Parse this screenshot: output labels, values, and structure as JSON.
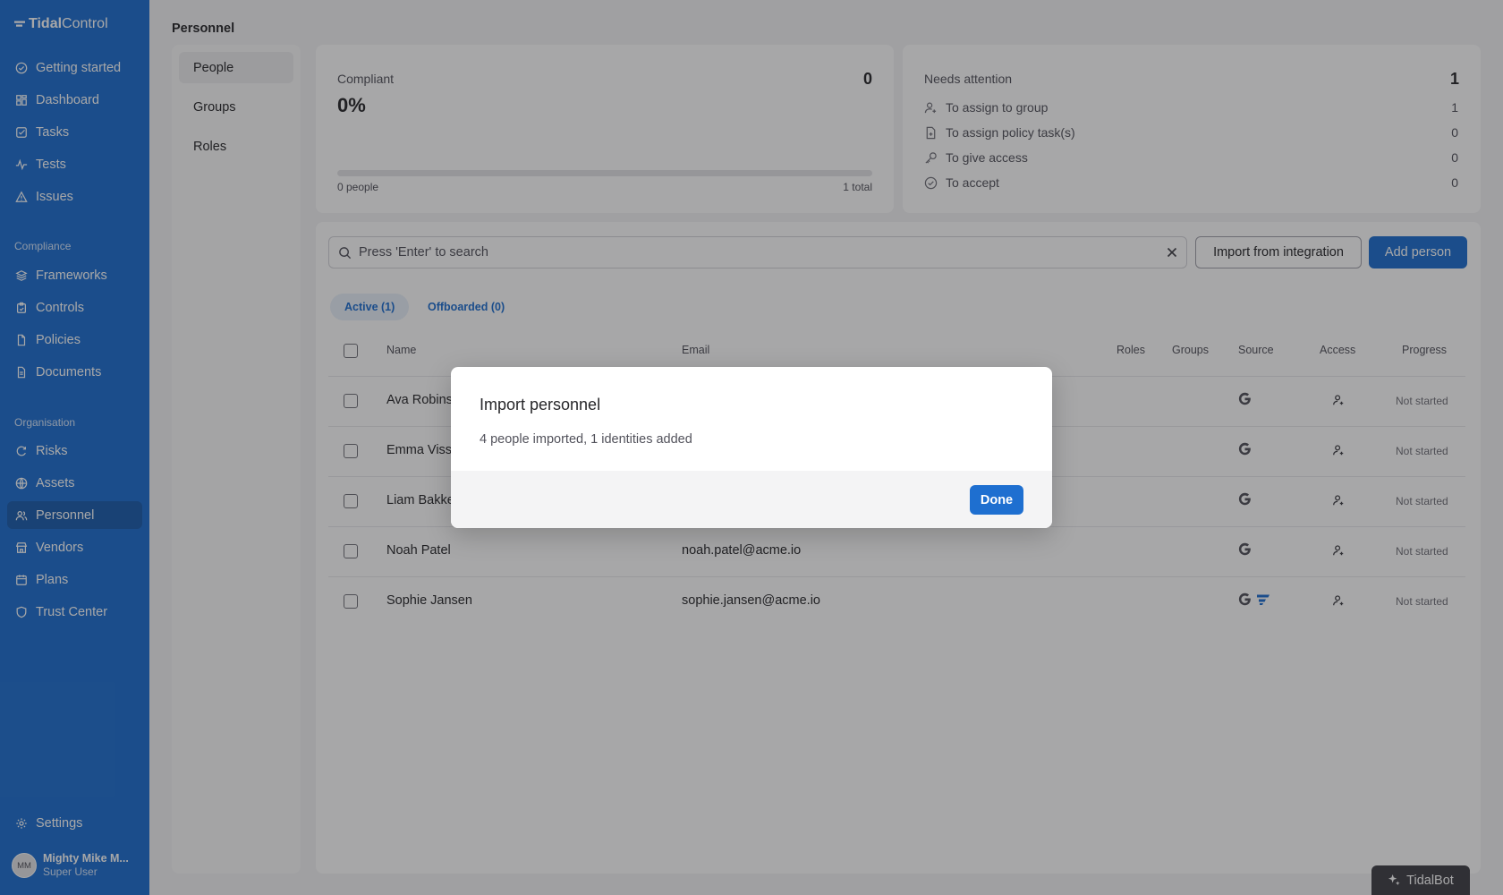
{
  "app": {
    "logo_bold": "Tidal",
    "logo_light": "Control"
  },
  "sidebar": {
    "top_items": [
      {
        "label": "Getting started",
        "icon": "check-circle-icon"
      },
      {
        "label": "Dashboard",
        "icon": "dashboard-icon"
      },
      {
        "label": "Tasks",
        "icon": "checkbox-icon"
      },
      {
        "label": "Tests",
        "icon": "pulse-icon"
      },
      {
        "label": "Issues",
        "icon": "warning-triangle-icon"
      }
    ],
    "compliance_title": "Compliance",
    "compliance_items": [
      {
        "label": "Frameworks",
        "icon": "layers-icon"
      },
      {
        "label": "Controls",
        "icon": "clipboard-icon"
      },
      {
        "label": "Policies",
        "icon": "file-icon"
      },
      {
        "label": "Documents",
        "icon": "document-icon"
      }
    ],
    "organisation_title": "Organisation",
    "organisation_items": [
      {
        "label": "Risks",
        "icon": "risk-icon"
      },
      {
        "label": "Assets",
        "icon": "globe-icon"
      },
      {
        "label": "Personnel",
        "icon": "users-icon",
        "active": true
      },
      {
        "label": "Vendors",
        "icon": "store-icon"
      },
      {
        "label": "Plans",
        "icon": "calendar-icon"
      },
      {
        "label": "Trust Center",
        "icon": "shield-icon"
      }
    ],
    "settings_label": "Settings",
    "user": {
      "initials": "MM",
      "name": "Mighty Mike M...",
      "role": "Super User"
    }
  },
  "page": {
    "title": "Personnel",
    "subnav": [
      "People",
      "Groups",
      "Roles"
    ]
  },
  "compliant_card": {
    "label": "Compliant",
    "percent": "0%",
    "count": "0",
    "progress_fraction": 0,
    "left_caption": "0 people",
    "right_caption": "1 total"
  },
  "attention_card": {
    "label": "Needs attention",
    "count": "1",
    "rows": [
      {
        "label": "To assign to group",
        "value": "1",
        "icon": "user-plus-icon"
      },
      {
        "label": "To assign policy task(s)",
        "value": "0",
        "icon": "file-plus-icon"
      },
      {
        "label": "To give access",
        "value": "0",
        "icon": "key-icon"
      },
      {
        "label": "To accept",
        "value": "0",
        "icon": "check-circle-icon"
      }
    ]
  },
  "toolbar": {
    "search_placeholder": "Press 'Enter' to search",
    "import_label": "Import from integration",
    "add_label": "Add person"
  },
  "tabs": {
    "active": "Active (1)",
    "offboarded": "Offboarded (0)"
  },
  "table": {
    "headers": {
      "name": "Name",
      "email": "Email",
      "roles": "Roles",
      "groups": "Groups",
      "source": "Source",
      "access": "Access",
      "progress": "Progress"
    },
    "rows": [
      {
        "name": "Ava Robins",
        "email": "",
        "sources": [
          "google-icon"
        ],
        "progress": "Not started"
      },
      {
        "name": "Emma Viss",
        "email": "",
        "sources": [
          "google-icon"
        ],
        "progress": "Not started"
      },
      {
        "name": "Liam Bakke",
        "email": "",
        "sources": [
          "google-icon"
        ],
        "progress": "Not started"
      },
      {
        "name": "Noah Patel",
        "email": "noah.patel@acme.io",
        "sources": [
          "google-icon"
        ],
        "progress": "Not started"
      },
      {
        "name": "Sophie Jansen",
        "email": "sophie.jansen@acme.io",
        "sources": [
          "google-icon",
          "tidal-icon"
        ],
        "progress": "Not started"
      }
    ]
  },
  "tidalbot": {
    "label": "TidalBot"
  },
  "modal": {
    "title": "Import personnel",
    "message": "4 people imported, 1 identities added",
    "done_label": "Done"
  },
  "colors": {
    "brand": "#1e6fd0",
    "sidebar": "#1e6fd0",
    "overlay": "rgba(24,24,27,0.38)"
  }
}
